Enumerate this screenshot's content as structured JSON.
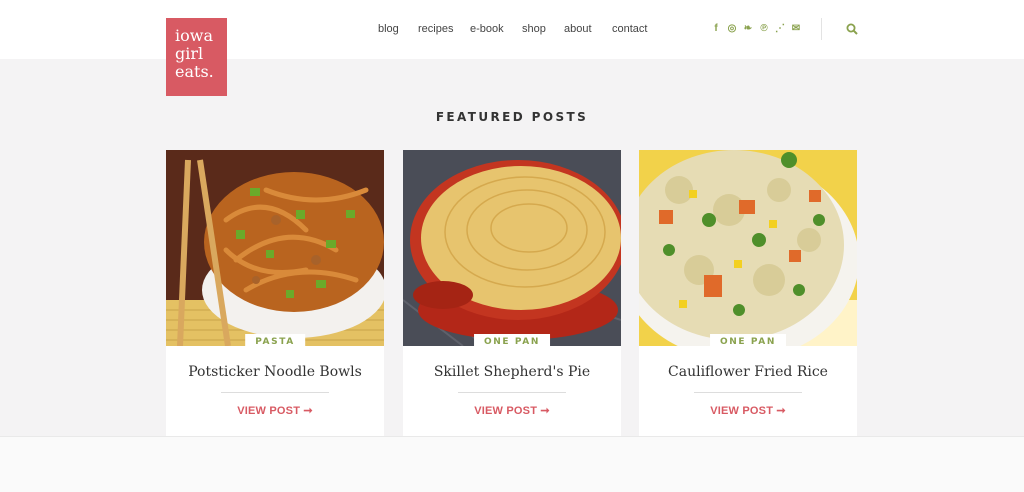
{
  "logo": {
    "lines": [
      "iowa",
      "girl",
      "eats."
    ]
  },
  "nav": {
    "items": [
      "blog",
      "recipes",
      "e-book",
      "shop",
      "about",
      "contact"
    ]
  },
  "social": {
    "icons": [
      "facebook-icon",
      "instagram-icon",
      "twitter-icon",
      "pinterest-icon",
      "rss-icon",
      "email-icon"
    ],
    "glyphs": [
      "f",
      "◎",
      "❧",
      "℗",
      "⋰",
      "✉"
    ]
  },
  "section": {
    "title": "FEATURED POSTS"
  },
  "cards": [
    {
      "badge": "PASTA",
      "title": "Potsticker Noodle Bowls",
      "link": "VIEW POST ➞"
    },
    {
      "badge": "ONE PAN",
      "title": "Skillet Shepherd's Pie",
      "link": "VIEW POST ➞"
    },
    {
      "badge": "ONE PAN",
      "title": "Cauliflower Fried Rice",
      "link": "VIEW POST ➞"
    }
  ],
  "colors": {
    "brand": "#d85a63",
    "accent": "#8aa24e",
    "text": "#333333"
  }
}
